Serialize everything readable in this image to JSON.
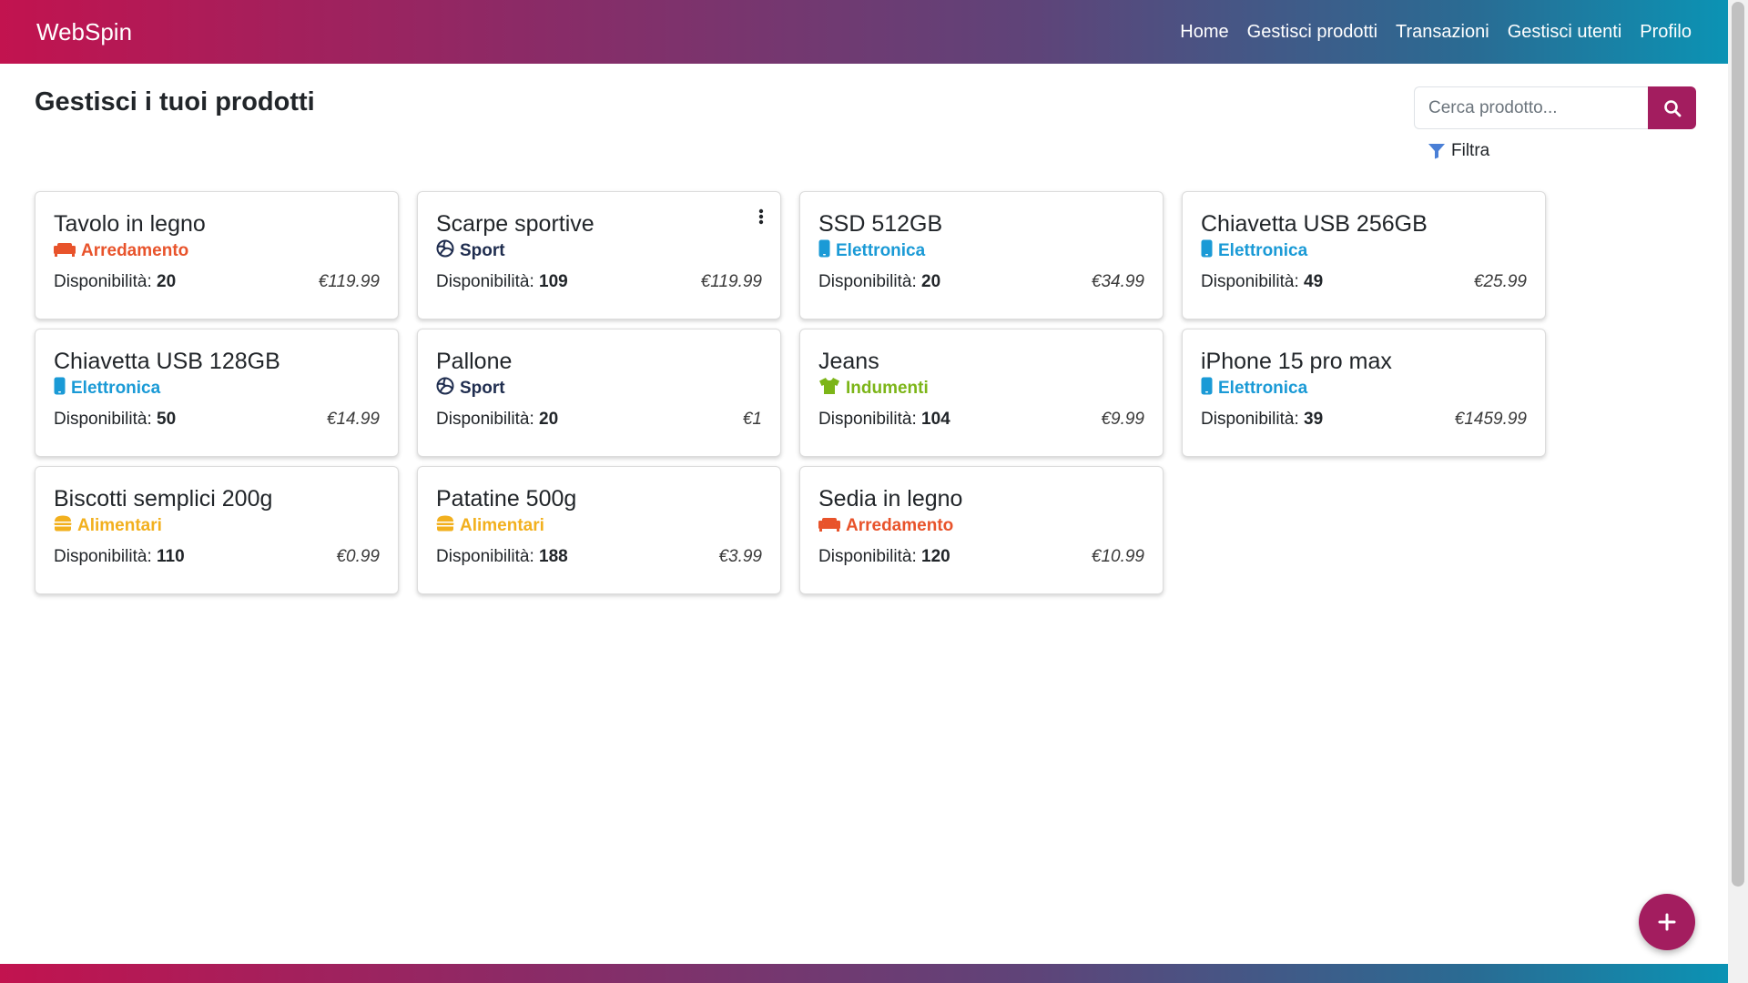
{
  "navbar": {
    "brand": "WebSpin",
    "links": [
      "Home",
      "Gestisci prodotti",
      "Transazioni",
      "Gestisci utenti",
      "Profilo"
    ]
  },
  "page": {
    "title": "Gestisci i tuoi prodotti",
    "search_placeholder": "Cerca prodotto...",
    "filter_label": "Filtra"
  },
  "availability_label": "Disponibilità:",
  "categories": {
    "Arredamento": {
      "color": "#e8532b",
      "icon": "couch-icon"
    },
    "Sport": {
      "color": "#1f2d4f",
      "icon": "volleyball-icon"
    },
    "Elettronica": {
      "color": "#1a9ad6",
      "icon": "mobile-icon"
    },
    "Indumenti": {
      "color": "#7cb518",
      "icon": "shirt-icon"
    },
    "Alimentari": {
      "color": "#f2b01e",
      "icon": "burger-icon"
    }
  },
  "products": [
    {
      "name": "Tavolo in legno",
      "category": "Arredamento",
      "stock": "20",
      "price": "€119.99"
    },
    {
      "name": "Scarpe sportive",
      "category": "Sport",
      "stock": "109",
      "price": "€119.99"
    },
    {
      "name": "SSD 512GB",
      "category": "Elettronica",
      "stock": "20",
      "price": "€34.99"
    },
    {
      "name": "Chiavetta USB 256GB",
      "category": "Elettronica",
      "stock": "49",
      "price": "€25.99"
    },
    {
      "name": "Chiavetta USB 128GB",
      "category": "Elettronica",
      "stock": "50",
      "price": "€14.99"
    },
    {
      "name": "Pallone",
      "category": "Sport",
      "stock": "20",
      "price": "€1"
    },
    {
      "name": "Jeans",
      "category": "Indumenti",
      "stock": "104",
      "price": "€9.99"
    },
    {
      "name": "iPhone 15 pro max",
      "category": "Elettronica",
      "stock": "39",
      "price": "€1459.99"
    },
    {
      "name": "Biscotti semplici 200g",
      "category": "Alimentari",
      "stock": "110",
      "price": "€0.99"
    },
    {
      "name": "Patatine 500g",
      "category": "Alimentari",
      "stock": "188",
      "price": "€3.99"
    },
    {
      "name": "Sedia in legno",
      "category": "Arredamento",
      "stock": "120",
      "price": "€10.99"
    }
  ],
  "colors": {
    "accent": "#a31d5f",
    "filter_icon": "#4a7fd6"
  }
}
